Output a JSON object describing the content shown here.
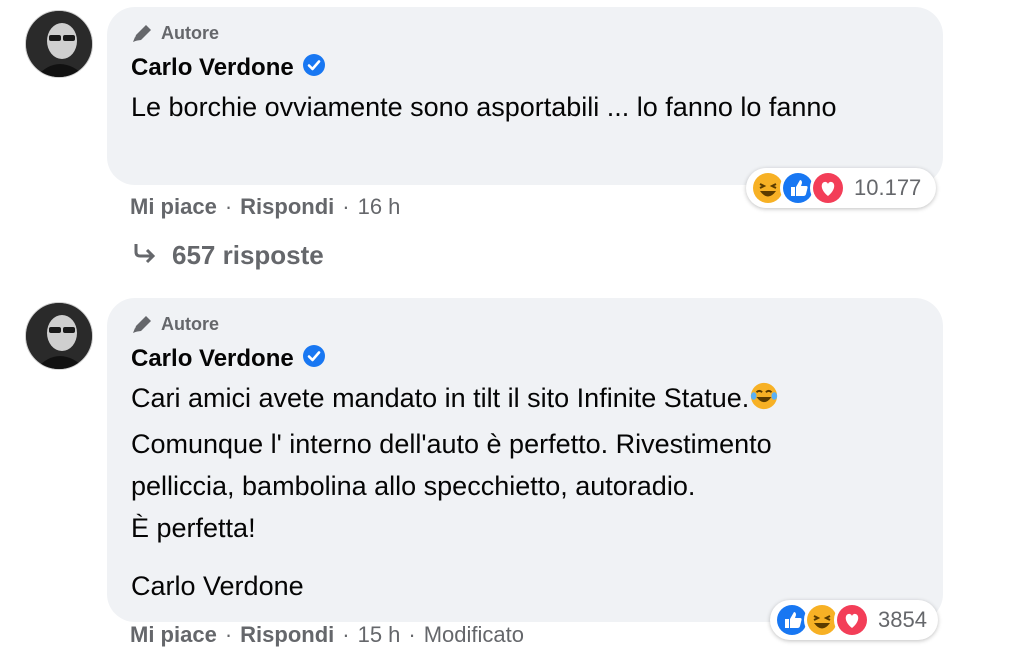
{
  "comments": [
    {
      "badge": "Autore",
      "author": "Carlo Verdone",
      "paragraphs": [
        "Le borchie ovviamente sono asportabili ... lo fanno lo fanno"
      ],
      "reaction_count": "10.177",
      "actions": {
        "like": "Mi piace",
        "reply": "Rispondi",
        "time": "16 h"
      },
      "replies_label": "657 risposte"
    },
    {
      "badge": "Autore",
      "author": "Carlo Verdone",
      "line1": "Cari amici avete mandato in tilt il sito Infinite Statue.",
      "line2": "Comunque l' interno dell'auto è perfetto. Rivestimento",
      "line3": "pelliccia, bambolina allo specchietto, autoradio.",
      "line4": "È perfetta!",
      "signature": "Carlo Verdone",
      "reaction_count": "3854",
      "actions": {
        "like": "Mi piace",
        "reply": "Rispondi",
        "time": "15 h",
        "edited": "Modificato"
      }
    }
  ],
  "icons": {
    "badge": "pencil-icon",
    "verified": "verified-badge-icon",
    "reactions": [
      "haha-icon",
      "like-icon",
      "love-icon"
    ],
    "replies": "reply-arrow-icon"
  },
  "colors": {
    "verified_blue": "#1877f2",
    "like_blue": "#1877f2",
    "love_red": "#f33e58",
    "haha_yellow": "#f7b125",
    "bubble_bg": "#f0f2f5"
  }
}
